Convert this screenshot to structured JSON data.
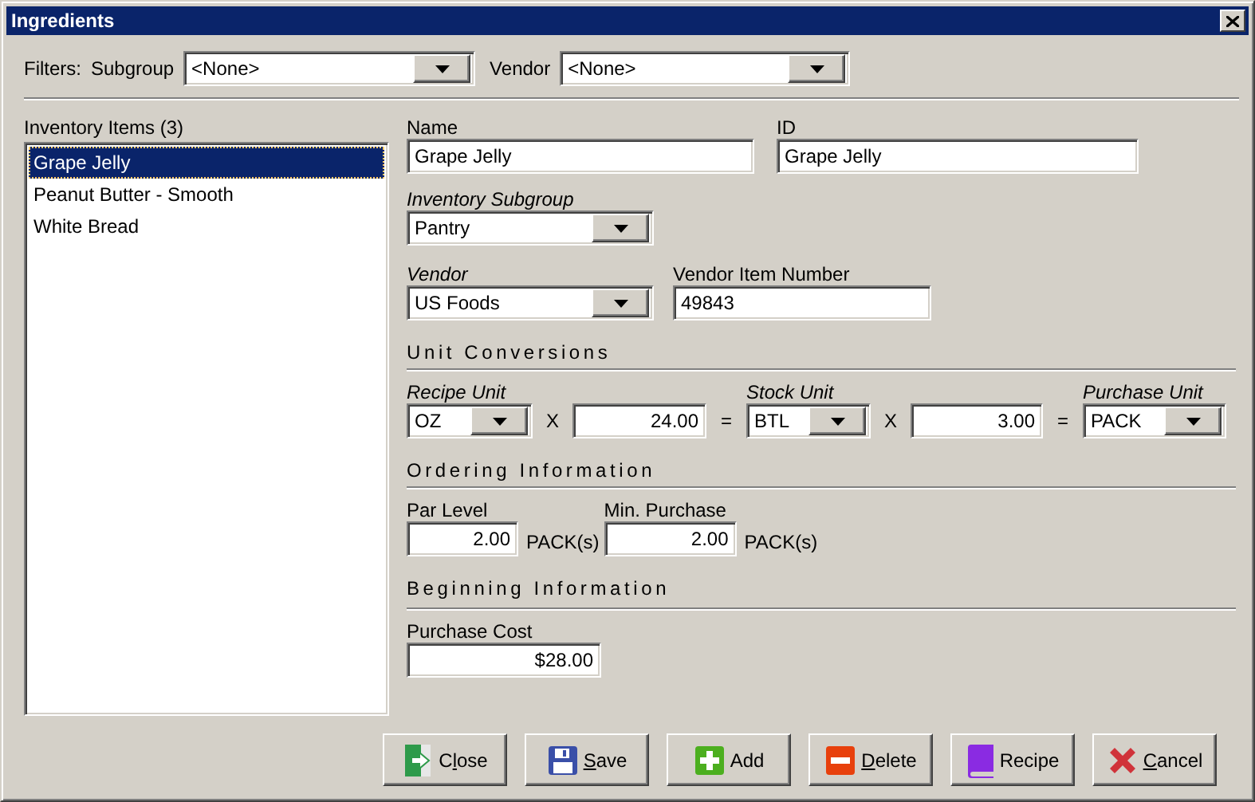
{
  "window": {
    "title": "Ingredients"
  },
  "filters": {
    "label": "Filters:",
    "subgroup": {
      "label": "Subgroup",
      "value": "<None>"
    },
    "vendor": {
      "label": "Vendor",
      "value": "<None>"
    }
  },
  "inventory": {
    "title": "Inventory Items (3)",
    "items": [
      {
        "label": "Grape Jelly",
        "selected": true
      },
      {
        "label": "Peanut Butter - Smooth",
        "selected": false
      },
      {
        "label": "White Bread",
        "selected": false
      }
    ]
  },
  "details": {
    "name": {
      "label": "Name",
      "value": "Grape Jelly"
    },
    "id": {
      "label": "ID",
      "value": "Grape Jelly"
    },
    "inventory_subgroup": {
      "label": "Inventory Subgroup",
      "value": "Pantry"
    },
    "vendor": {
      "label": "Vendor",
      "value": "US Foods"
    },
    "vendor_item_number": {
      "label": "Vendor Item Number",
      "value": "49843"
    }
  },
  "unit_conversions": {
    "heading": "Unit Conversions",
    "recipe_unit": {
      "label": "Recipe Unit",
      "value": "OZ"
    },
    "multiply_1": "X",
    "recipe_per_stock": "24.00",
    "equals_1": "=",
    "stock_unit": {
      "label": "Stock Unit",
      "value": "BTL"
    },
    "multiply_2": "X",
    "stock_per_purchase": "3.00",
    "equals_2": "=",
    "purchase_unit": {
      "label": "Purchase Unit",
      "value": "PACK"
    }
  },
  "ordering": {
    "heading": "Ordering Information",
    "par_level": {
      "label": "Par Level",
      "value": "2.00",
      "unit": "PACK(s)"
    },
    "min_purchase": {
      "label": "Min. Purchase",
      "value": "2.00",
      "unit": "PACK(s)"
    }
  },
  "beginning": {
    "heading": "Beginning Information",
    "purchase_cost": {
      "label": "Purchase Cost",
      "value": "$28.00"
    }
  },
  "buttons": [
    {
      "kind": "close",
      "label_start": "C",
      "access_key": "l",
      "label_end": "ose"
    },
    {
      "kind": "save",
      "access_key": "S",
      "label_end": "ave"
    },
    {
      "kind": "add",
      "label": "Add"
    },
    {
      "kind": "delete",
      "access_key": "D",
      "label_end": "elete"
    },
    {
      "kind": "recipe",
      "label": "Recipe"
    },
    {
      "kind": "cancel",
      "access_key": "C",
      "label_end": "ancel"
    }
  ]
}
